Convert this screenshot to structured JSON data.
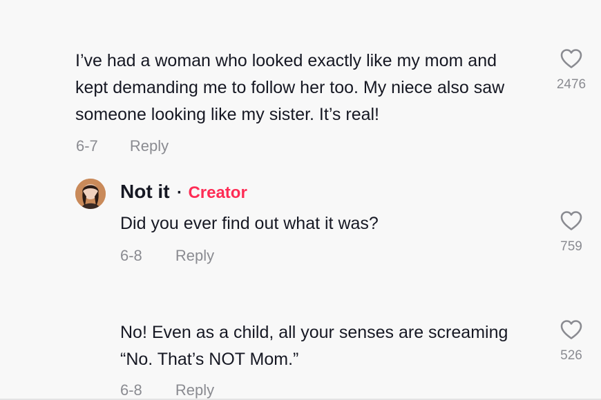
{
  "comments": [
    {
      "text": "I’ve had a woman who looked exactly like my mom and kept demanding me to follow her too. My niece also saw someone looking like my sister. It’s real!",
      "date": "6-7",
      "reply_label": "Reply",
      "likes": "2476",
      "like_icon": "heart-outline-icon"
    },
    {
      "author": "Not it",
      "separator": "·",
      "badge": "Creator",
      "text": "Did you ever find out what it was?",
      "date": "6-8",
      "reply_label": "Reply",
      "likes": "759",
      "like_icon": "heart-outline-icon"
    },
    {
      "text": "No! Even as a child, all your senses are screaming “No. That’s NOT Mom.”",
      "date": "6-8",
      "reply_label": "Reply",
      "likes": "526",
      "like_icon": "heart-outline-icon"
    }
  ],
  "colors": {
    "background": "#f8f8f8",
    "text": "#161823",
    "muted": "#8a8b91",
    "creator_badge": "#fe2c55"
  }
}
